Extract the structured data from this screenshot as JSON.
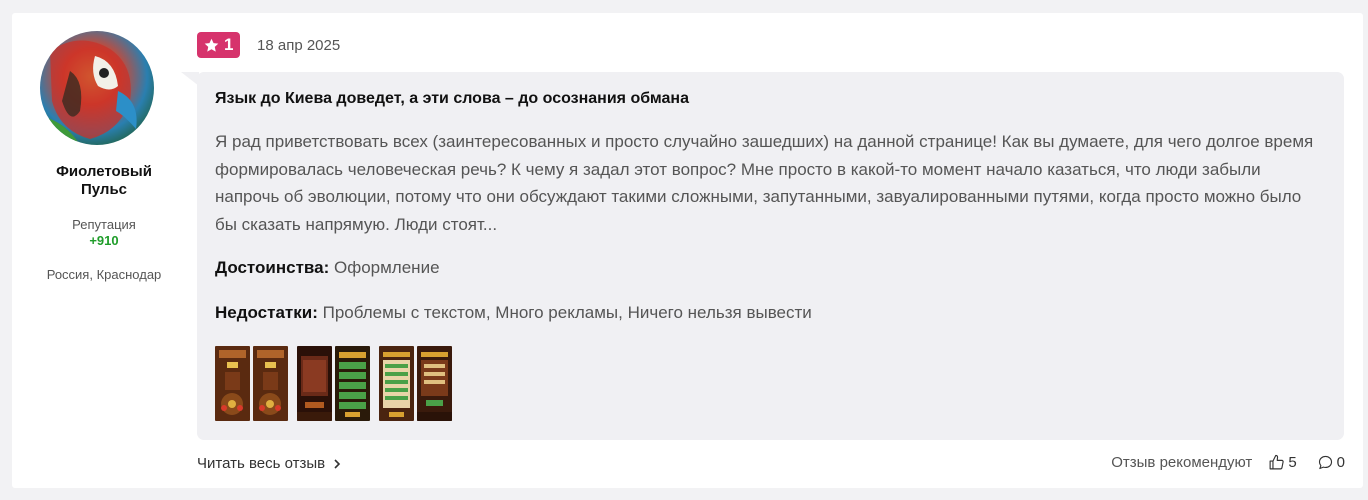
{
  "author": {
    "name_line1": "Фиолетовый",
    "name_line2": "Пульс",
    "reputation_label": "Репутация",
    "reputation_value": "+910",
    "location": "Россия, Краснодар"
  },
  "review": {
    "rating": "1",
    "date": "18 апр 2025",
    "title": "Язык до Киева доведет, а эти слова – до осознания обмана",
    "text": "Я рад приветствовать всех (заинтересованных и просто случайно зашедших) на данной странице! Как вы думаете, для чего долгое время формировалась человеческая речь? К чему я задал этот вопрос? Мне просто в какой-то момент начало казаться, что люди забыли напрочь об эволюции, потому что они обсуждают такими сложными, запутанными, завуалированными путями, когда просто можно было бы сказать напрямую. Люди стоят...",
    "pros_label": "Достоинства:",
    "pros_value": "Оформление",
    "cons_label": "Недостатки:",
    "cons_value": "Проблемы с текстом, Много рекламы, Ничего нельзя вывести",
    "screenshots_count": 6
  },
  "footer": {
    "read_full_label": "Читать весь отзыв",
    "recommend_label": "Отзыв рекомендуют",
    "likes_count": "5",
    "comments_count": "0"
  },
  "icons": {
    "rating": "star-icon",
    "read_more": "chevron-right-icon",
    "like": "thumbs-up-icon",
    "comment": "comment-icon"
  },
  "colors": {
    "rating_badge": "#d6336c",
    "reputation": "#1f9d2a",
    "bubble": "#f0f0f3"
  }
}
